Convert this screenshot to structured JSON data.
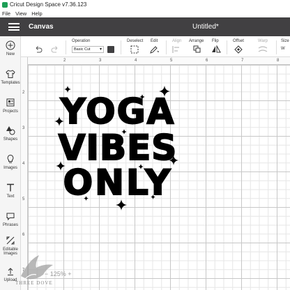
{
  "window": {
    "title": "Cricut Design Space  v7.36.123"
  },
  "menu": [
    "File",
    "View",
    "Help"
  ],
  "header": {
    "section": "Canvas",
    "document_title": "Untitled*"
  },
  "sidebar": {
    "items": [
      {
        "label": "New",
        "icon": "plus-circle-icon"
      },
      {
        "label": "Templates",
        "icon": "shirt-icon"
      },
      {
        "label": "Projects",
        "icon": "projects-icon"
      },
      {
        "label": "Shapes",
        "icon": "shapes-icon"
      },
      {
        "label": "Images",
        "icon": "bulb-icon"
      },
      {
        "label": "Text",
        "icon": "text-icon"
      },
      {
        "label": "Phrases",
        "icon": "speech-bubble-icon"
      },
      {
        "label": "Editable",
        "label2": "Images",
        "icon": "editable-icon"
      },
      {
        "label": "Upload",
        "icon": "upload-icon"
      }
    ]
  },
  "toolbar": {
    "operation_label": "Operation",
    "operation_value": "Basic Cut",
    "deselect_label": "Deselect",
    "edit_label": "Edit",
    "align_label": "Align",
    "arrange_label": "Arrange",
    "flip_label": "Flip",
    "offset_label": "Offset",
    "warp_label": "Warp",
    "size_label": "Size",
    "color": "#414042"
  },
  "rulers": {
    "top": [
      "2",
      "3",
      "4",
      "5",
      "6",
      "7",
      "8"
    ],
    "left": [
      "2",
      "3",
      "4",
      "5",
      "6",
      "7"
    ]
  },
  "design": {
    "line1": "YOGA",
    "line2": "VIBES",
    "line3": "ONLY"
  },
  "zoom": "125%",
  "watermark": "THREE DOVE"
}
